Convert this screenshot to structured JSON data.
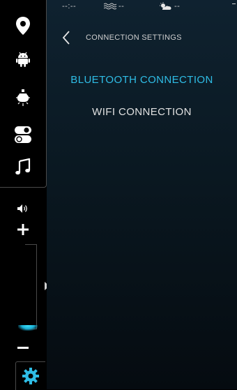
{
  "status_bar": {
    "time": "--:--",
    "water_value": "--",
    "weather_value": "--",
    "edge_value": "-"
  },
  "header": {
    "title": "CONNECTION SETTINGS"
  },
  "menu": [
    {
      "label": "BLUETOOTH CONNECTION",
      "active": true
    },
    {
      "label": "WIFI CONNECTION",
      "active": false
    }
  ],
  "sidebar": {
    "items": [
      "map-pin-icon",
      "android-icon",
      "light-bulb-icon",
      "toggle-icon",
      "music-note-icon"
    ],
    "volume": {
      "level": 0.05
    },
    "settings": "gear-icon"
  },
  "colors": {
    "accent": "#2fbde6",
    "text": "#e0e0e0",
    "rail_border": "#4a4a4a"
  }
}
